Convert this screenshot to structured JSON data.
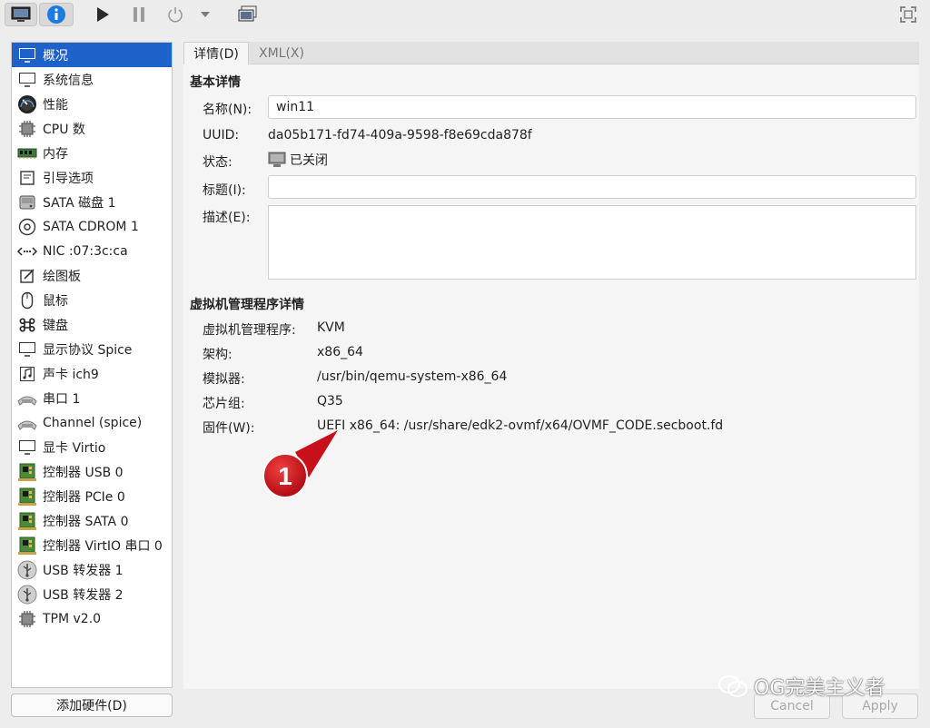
{
  "sidebar": {
    "items": [
      {
        "label": "概况",
        "icon": "monitor-icon",
        "selected": true
      },
      {
        "label": "系统信息",
        "icon": "monitor-icon"
      },
      {
        "label": "性能",
        "icon": "gauge-icon"
      },
      {
        "label": "CPU 数",
        "icon": "chip-icon"
      },
      {
        "label": "内存",
        "icon": "memory-icon"
      },
      {
        "label": "引导选项",
        "icon": "boot-icon"
      },
      {
        "label": "SATA 磁盘 1",
        "icon": "disk-icon"
      },
      {
        "label": "SATA CDROM 1",
        "icon": "cdrom-icon"
      },
      {
        "label": "NIC :07:3c:ca",
        "icon": "network-icon"
      },
      {
        "label": "绘图板",
        "icon": "tablet-icon"
      },
      {
        "label": "鼠标",
        "icon": "mouse-icon"
      },
      {
        "label": "键盘",
        "icon": "keyboard-icon"
      },
      {
        "label": "显示协议 Spice",
        "icon": "monitor-icon"
      },
      {
        "label": "声卡 ich9",
        "icon": "sound-icon"
      },
      {
        "label": "串口 1",
        "icon": "serial-icon"
      },
      {
        "label": "Channel (spice)",
        "icon": "serial-icon"
      },
      {
        "label": "显卡 Virtio",
        "icon": "monitor-icon"
      },
      {
        "label": "控制器 USB 0",
        "icon": "controller-icon"
      },
      {
        "label": "控制器 PCIe 0",
        "icon": "controller-icon"
      },
      {
        "label": "控制器 SATA 0",
        "icon": "controller-icon"
      },
      {
        "label": "控制器 VirtIO 串口 0",
        "icon": "controller-icon"
      },
      {
        "label": "USB 转发器 1",
        "icon": "usb-icon"
      },
      {
        "label": "USB 转发器 2",
        "icon": "usb-icon"
      },
      {
        "label": "TPM v2.0",
        "icon": "chip-icon"
      }
    ],
    "add_hardware": "添加硬件(D)"
  },
  "tabs": {
    "details": "详情(D)",
    "xml": "XML(X)"
  },
  "basic": {
    "section_title": "基本详情",
    "name_label": "名称(N):",
    "name_value": "win11",
    "uuid_label": "UUID:",
    "uuid_value": "da05b171-fd74-409a-9598-f8e69cda878f",
    "status_label": "状态:",
    "status_value": "已关闭",
    "title_label": "标题(I):",
    "title_value": "",
    "desc_label": "描述(E):",
    "desc_value": ""
  },
  "hypervisor": {
    "section_title": "虚拟机管理程序详情",
    "hv_label": "虚拟机管理程序:",
    "hv_value": "KVM",
    "arch_label": "架构:",
    "arch_value": "x86_64",
    "emu_label": "模拟器:",
    "emu_value": "/usr/bin/qemu-system-x86_64",
    "chipset_label": "芯片组:",
    "chipset_value": "Q35",
    "fw_label": "固件(W):",
    "fw_value": "UEFI x86_64: /usr/share/edk2-ovmf/x64/OVMF_CODE.secboot.fd"
  },
  "callout": {
    "number": "1",
    "color": "#d0101a"
  },
  "buttons": {
    "cancel": "Cancel",
    "apply": "Apply"
  },
  "watermark": {
    "text": "OG完美主义者"
  },
  "colors": {
    "selection": "#1c62c8",
    "info_button": "#1a7ce0"
  }
}
